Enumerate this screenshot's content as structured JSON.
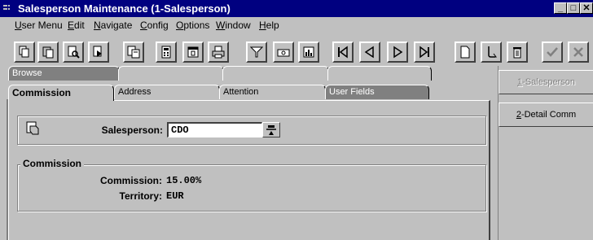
{
  "window": {
    "title": "Salesperson Maintenance (1-Salesperson)",
    "controls": [
      "_",
      "□",
      "✕"
    ]
  },
  "menu": [
    {
      "label": "User Menu",
      "u": "U",
      "rest": "ser Menu"
    },
    {
      "label": "Edit",
      "u": "E",
      "rest": "dit"
    },
    {
      "label": "Navigate",
      "u": "N",
      "rest": "avigate"
    },
    {
      "label": "Config",
      "u": "C",
      "rest": "onfig"
    },
    {
      "label": "Options",
      "u": "O",
      "rest": "ptions"
    },
    {
      "label": "Window",
      "u": "W",
      "rest": "indow"
    },
    {
      "label": "Help",
      "u": "H",
      "rest": "elp"
    }
  ],
  "toolbar": {
    "buttons": [
      "copy-icon",
      "paste-icon",
      "find-icon",
      "find-next-icon",
      "zoom-icon",
      "calculator-icon",
      "calendar-icon",
      "print-icon",
      "filter-icon",
      "notes-icon",
      "report-icon",
      "first-record-icon",
      "previous-record-icon",
      "next-record-icon",
      "last-record-icon",
      "new-record-icon",
      "undo-icon",
      "delete-icon",
      "save-check-icon",
      "cancel-x-icon"
    ]
  },
  "tabs": {
    "row1": [
      "Browse",
      "",
      "",
      ""
    ],
    "row2": [
      "Commission",
      "Address",
      "Attention",
      "User Fields"
    ]
  },
  "salesperson": {
    "label": "Salesperson:",
    "value": "CDO"
  },
  "commission": {
    "group_title": "Commission",
    "commission_label": "Commission:",
    "commission_value": "15.00%",
    "territory_label": "Territory:",
    "territory_value": "EUR"
  },
  "right_panel": {
    "buttons": [
      {
        "u": "1",
        "rest": "-Salesperson",
        "enabled": false
      },
      {
        "u": "2",
        "rest": "-Detail Comm",
        "enabled": true
      }
    ]
  }
}
